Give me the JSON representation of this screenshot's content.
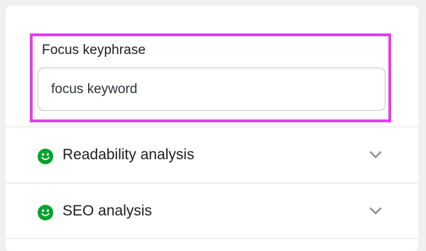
{
  "focus_keyphrase": {
    "label": "Focus keyphrase",
    "value": "focus keyword",
    "highlight_color": "#e63cf0"
  },
  "sections": [
    {
      "label": "Readability analysis",
      "status": "good",
      "status_icon": "smiley-icon",
      "status_color": "#00a32a",
      "expand_icon": "chevron-down-icon"
    },
    {
      "label": "SEO analysis",
      "status": "good",
      "status_icon": "smiley-icon",
      "status_color": "#00a32a",
      "expand_icon": "chevron-down-icon"
    }
  ]
}
